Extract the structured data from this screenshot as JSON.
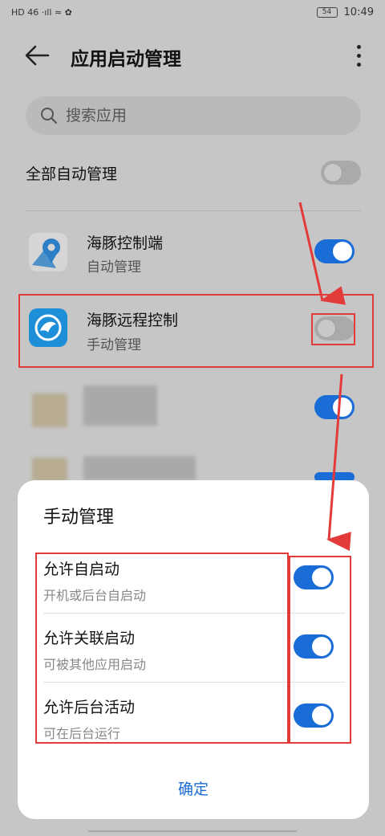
{
  "status": {
    "left_text": "HD 46 ·ıll ≈ ✿",
    "battery": "54",
    "time": "10:49"
  },
  "header": {
    "title": "应用启动管理"
  },
  "search": {
    "placeholder": "搜索应用"
  },
  "all": {
    "label": "全部自动管理",
    "on": false
  },
  "apps": [
    {
      "name": "海豚控制端",
      "sub": "自动管理",
      "on": true
    },
    {
      "name": "海豚远程控制",
      "sub": "手动管理",
      "on": false
    }
  ],
  "sheet": {
    "title": "手动管理",
    "options": [
      {
        "title": "允许自启动",
        "sub": "开机或后台自启动",
        "on": true
      },
      {
        "title": "允许关联启动",
        "sub": "可被其他应用启动",
        "on": true
      },
      {
        "title": "允许后台活动",
        "sub": "可在后台运行",
        "on": true
      }
    ],
    "confirm": "确定"
  },
  "colors": {
    "accent": "#1a6cd6",
    "highlight": "#e33a3a",
    "dim_bg": "#c6c6c6"
  }
}
